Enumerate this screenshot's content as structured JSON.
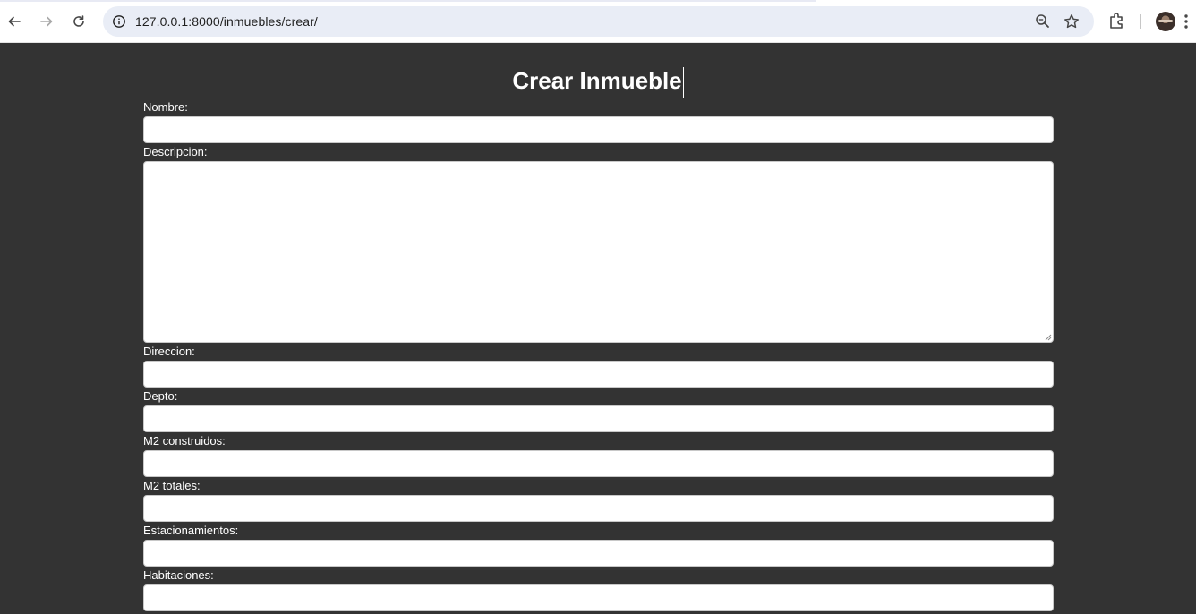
{
  "browser": {
    "url": "127.0.0.1:8000/inmuebles/crear/",
    "icons": {
      "back": "arrow-left-icon",
      "forward": "arrow-right-icon",
      "reload": "reload-icon",
      "site_info": "info-icon",
      "zoom": "zoom-icon",
      "bookmark": "star-icon",
      "extensions": "puzzle-icon",
      "profile": "avatar",
      "menu": "kebab-menu-icon"
    }
  },
  "form": {
    "title": "Crear Inmueble",
    "fields": [
      {
        "label": "Nombre:",
        "value": ""
      },
      {
        "label": "Descripcion:",
        "value": ""
      },
      {
        "label": "Direccion:",
        "value": ""
      },
      {
        "label": "Depto:",
        "value": ""
      },
      {
        "label": "M2 construidos:",
        "value": ""
      },
      {
        "label": "M2 totales:",
        "value": ""
      },
      {
        "label": "Estacionamientos:",
        "value": ""
      },
      {
        "label": "Habitaciones:",
        "value": ""
      }
    ]
  },
  "colors": {
    "page_background": "#333333",
    "toolbar_background": "#ffffff",
    "omnibox_background": "#e9edf6",
    "text": "#ffffff"
  }
}
